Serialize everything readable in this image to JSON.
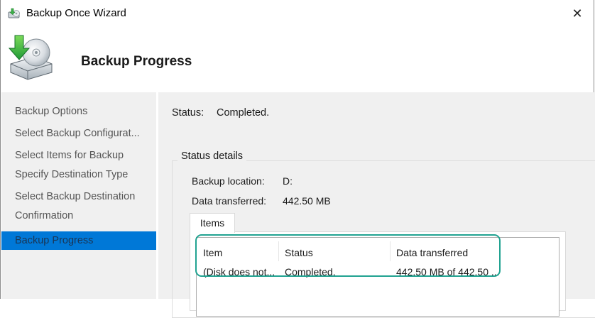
{
  "window": {
    "title": "Backup Once Wizard",
    "close_glyph": "✕",
    "icon": "backup-wizard-icon"
  },
  "header": {
    "title": "Backup Progress",
    "icon": "backup-disk-arrow-icon"
  },
  "sidebar": {
    "items": [
      {
        "label": "Backup Options"
      },
      {
        "label": "Select Backup Configurat..."
      },
      {
        "label": "Select Items for Backup"
      },
      {
        "label": "Specify Destination Type"
      },
      {
        "label": "Select Backup Destination"
      },
      {
        "label": "Confirmation"
      },
      {
        "label": "Backup Progress",
        "active": true
      }
    ]
  },
  "status": {
    "label": "Status:",
    "value": "Completed."
  },
  "details": {
    "group_title": "Status details",
    "location_label": "Backup location:",
    "location_value": "D:",
    "transferred_label": "Data transferred:",
    "transferred_value": "442.50 MB"
  },
  "items_tab": {
    "label": "Items"
  },
  "table": {
    "columns": [
      "Item",
      "Status",
      "Data transferred"
    ],
    "rows": [
      [
        "(Disk does not...",
        "Completed.",
        "442.50 MB of 442.50 ..."
      ]
    ]
  },
  "colors": {
    "accent": "#0078d7",
    "highlight": "#21a391",
    "panel": "#f0f0f0"
  }
}
